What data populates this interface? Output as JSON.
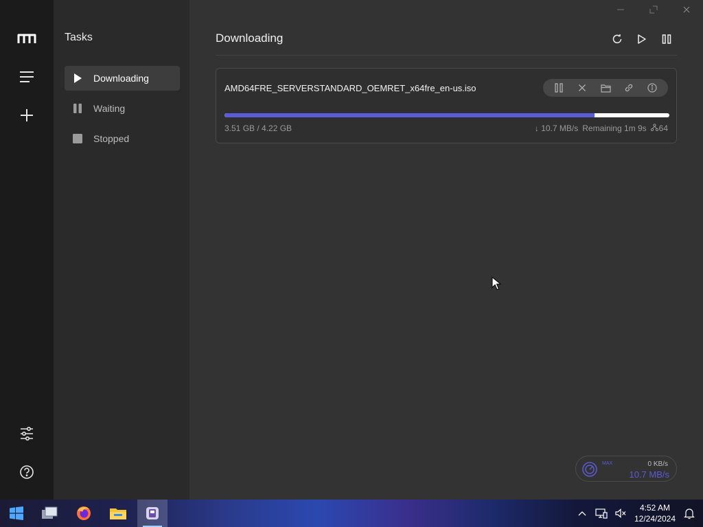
{
  "sidebar": {
    "logo_icon": "motrix-logo-icon",
    "items": [
      {
        "icon": "menu-icon",
        "name": "tasks-menu"
      },
      {
        "icon": "plus-icon",
        "name": "add-task"
      },
      {
        "icon": "sliders-icon",
        "name": "preferences"
      },
      {
        "icon": "help-icon",
        "name": "help"
      }
    ]
  },
  "subnav": {
    "title": "Tasks",
    "items": [
      {
        "label": "Downloading",
        "icon": "play-icon",
        "active": true
      },
      {
        "label": "Waiting",
        "icon": "pause-icon",
        "active": false
      },
      {
        "label": "Stopped",
        "icon": "stop-icon",
        "active": false
      }
    ]
  },
  "main": {
    "title": "Downloading",
    "toolbar": [
      "refresh-icon",
      "resume-all-icon",
      "pause-all-icon"
    ]
  },
  "task": {
    "name": "AMD64FRE_SERVERSTANDARD_OEMRET_x64fre_en-us.iso",
    "size": "3.51 GB / 4.22 GB",
    "progress": 0.832,
    "speed": "↓ 10.7 MB/s",
    "remaining": "Remaining 1m 9s",
    "connections": "64",
    "actions": [
      "pause-icon",
      "delete-icon",
      "folder-icon",
      "link-icon",
      "info-icon"
    ]
  },
  "speedometer": {
    "mode": "MAX",
    "upload": "0 KB/s",
    "download": "10.7 MB/s"
  },
  "taskbar": {
    "time": "4:52 AM",
    "date": "12/24/2024"
  },
  "colors": {
    "accent": "#5b5bd6",
    "sidebar": "#1b1b1b",
    "subnav": "#2a2a2a",
    "main": "#333333"
  }
}
